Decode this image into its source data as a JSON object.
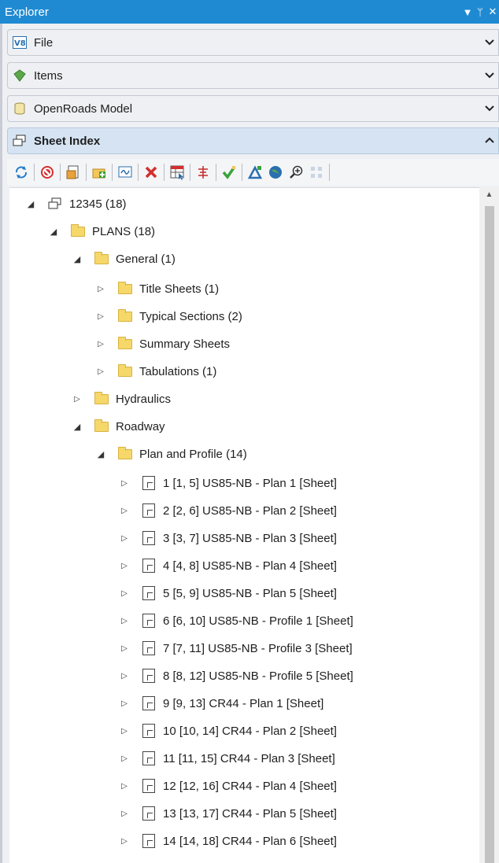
{
  "window": {
    "title": "Explorer",
    "controls": [
      "▼",
      "ᛘ",
      "✕"
    ]
  },
  "sections": [
    {
      "label": "File",
      "icon": "v8-icon",
      "chevron": "⌄"
    },
    {
      "label": "Items",
      "icon": "gem-icon",
      "chevron": "⌄"
    },
    {
      "label": "OpenRoads Model",
      "icon": "model-icon",
      "chevron": "⌄"
    },
    {
      "label": "Sheet Index",
      "icon": "sheet-index-icon",
      "chevron": "⌃"
    }
  ],
  "toolbar": {
    "icons": [
      "refresh-icon",
      "delete-index-icon",
      "add-sheet-icon",
      "add-folder-icon",
      "add-model-icon",
      "remove-icon",
      "properties-icon",
      "sort-icon",
      "check-icon",
      "markup-icon",
      "globe-icon",
      "zoom-icon",
      "grid-icon"
    ]
  },
  "tree": {
    "root": "12345 (18)",
    "plans": "PLANS (18)",
    "general": "General (1)",
    "general_children": [
      "Title Sheets (1)",
      "Typical Sections (2)",
      "Summary Sheets",
      "Tabulations (1)"
    ],
    "hydraulics": "Hydraulics",
    "roadway": "Roadway",
    "plan_profile": "Plan and Profile (14)",
    "sheets": [
      "1 [1, 5] US85-NB - Plan 1 [Sheet]",
      "2 [2, 6] US85-NB - Plan 2 [Sheet]",
      "3 [3, 7] US85-NB - Plan 3 [Sheet]",
      "4 [4, 8] US85-NB - Plan 4 [Sheet]",
      "5 [5, 9] US85-NB - Plan 5 [Sheet]",
      "6 [6, 10] US85-NB - Profile 1 [Sheet]",
      "7 [7, 11] US85-NB - Profile 3 [Sheet]",
      "8 [8, 12] US85-NB - Profile 5 [Sheet]",
      "9 [9, 13] CR44 - Plan 1 [Sheet]",
      "10 [10, 14] CR44 - Plan 2 [Sheet]",
      "11 [11, 15] CR44 - Plan 3 [Sheet]",
      "12 [12, 16] CR44 - Plan 4 [Sheet]",
      "13 [13, 17] CR44 - Plan 5 [Sheet]",
      "14 [14, 18] CR44 - Plan 6 [Sheet]"
    ]
  }
}
